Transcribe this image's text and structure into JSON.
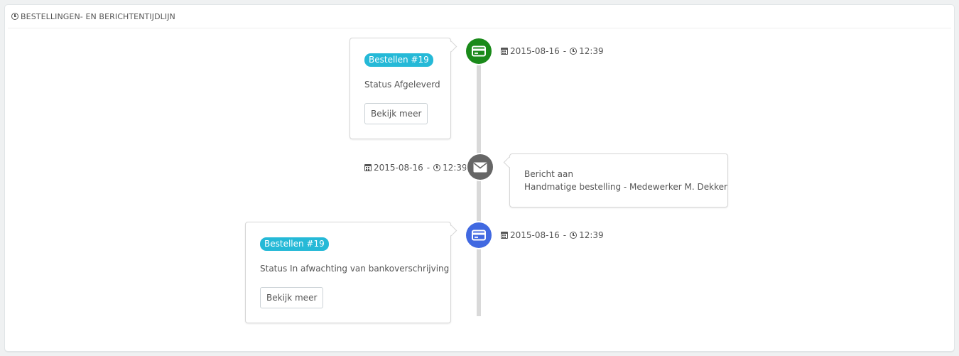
{
  "panel": {
    "title": "BESTELLINGEN- EN BERICHTENTIJDLIJN",
    "title_icon": "clock-icon"
  },
  "timeline": {
    "items": [
      {
        "type": "order",
        "icon": "credit-card-icon",
        "icon_color": "#1a8a1a",
        "date": "2015-08-16",
        "separator": "-",
        "time": "12:39",
        "badge": "Bestellen #19",
        "status": "Status Afgeleverd",
        "button": "Bekijk meer"
      },
      {
        "type": "message",
        "icon": "envelope-icon",
        "icon_color": "#666666",
        "date": "2015-08-16",
        "separator": "-",
        "time": "12:39",
        "line1": "Bericht aan",
        "line2": "Handmatige bestelling - Medewerker M. Dekker"
      },
      {
        "type": "order",
        "icon": "credit-card-icon",
        "icon_color": "#4169e1",
        "date": "2015-08-16",
        "separator": "-",
        "time": "12:39",
        "badge": "Bestellen #19",
        "status": "Status In afwachting van bankoverschrijving",
        "button": "Bekijk meer"
      }
    ]
  },
  "colors": {
    "badge": "#25b9d7",
    "line": "#d9d9d9"
  }
}
